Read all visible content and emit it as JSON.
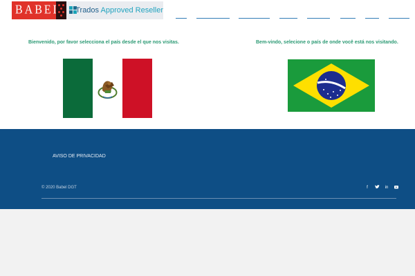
{
  "brand": {
    "babel_text": "BABEL",
    "trados_prefix": "Trados",
    "trados_suffix": "Approved Reseller"
  },
  "main": {
    "welcome_es": "Bienvenido, por favor selecciona el país desde el que nos visitas.",
    "welcome_pt": "Bem-vindo, selecione o país de onde você está nos visitando."
  },
  "footer": {
    "privacy_link": "AVISO DE PRIVACIDAD",
    "copyright": "© 2020 Babel DGT",
    "socials": [
      "facebook-icon",
      "twitter-icon",
      "linkedin-icon",
      "youtube-icon"
    ]
  },
  "colors": {
    "brand_red": "#e0322a",
    "footer_blue": "#0e4e85",
    "welcome_green": "#2c9a74",
    "trados_teal": "#1ba3b8"
  }
}
